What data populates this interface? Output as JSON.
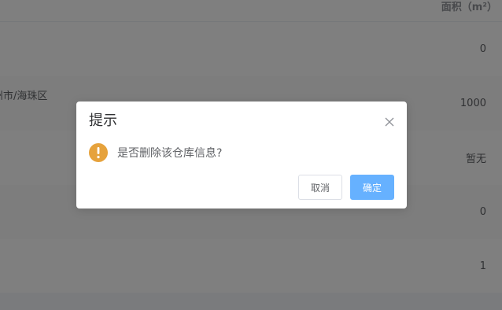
{
  "table": {
    "header": {
      "area_label": "面积（m²）"
    },
    "rows": [
      {
        "address": "",
        "area": "0"
      },
      {
        "address": "州市/海珠区",
        "area": "1000"
      },
      {
        "address": "",
        "area": "暂无"
      },
      {
        "address": "",
        "area": "0"
      },
      {
        "address": "",
        "area": "1"
      }
    ]
  },
  "dialog": {
    "title": "提示",
    "message": "是否删除该仓库信息?",
    "icon": "warning-icon",
    "cancel_label": "取消",
    "confirm_label": "确定"
  },
  "colors": {
    "warning": "#e6a23c",
    "primary_light": "#66b1ff",
    "text_primary": "#303133",
    "text_regular": "#606266"
  }
}
